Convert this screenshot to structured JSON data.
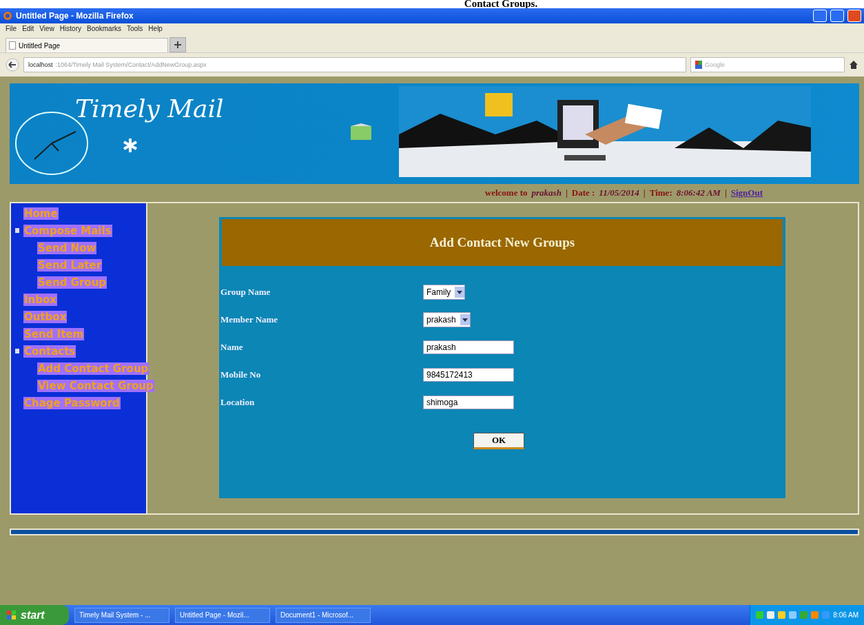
{
  "doc_heading": "Contact Groups.",
  "window": {
    "title": "Untitled Page - Mozilla Firefox"
  },
  "menu": [
    "File",
    "Edit",
    "View",
    "History",
    "Bookmarks",
    "Tools",
    "Help"
  ],
  "tabs": [
    {
      "label": "Untitled Page",
      "selected": true
    }
  ],
  "address": {
    "host": "localhost",
    "path": ":1064/Timely Mail System/Contact/AddNewGroup.aspx"
  },
  "search": {
    "placeholder": "Google"
  },
  "banner": {
    "title": "Timely Mail"
  },
  "welcome": [
    {
      "kind": "label",
      "text": "welcome to"
    },
    {
      "kind": "value",
      "text": "prakash"
    },
    {
      "kind": "sep",
      "text": "|"
    },
    {
      "kind": "label",
      "text": "Date :"
    },
    {
      "kind": "value",
      "text": "11/05/2014"
    },
    {
      "kind": "sep",
      "text": "|"
    },
    {
      "kind": "label",
      "text": "Time:"
    },
    {
      "kind": "value",
      "text": "8:06:42 AM"
    },
    {
      "kind": "sep",
      "text": "|"
    },
    {
      "kind": "link",
      "text": "SignOut"
    }
  ],
  "sidebar": {
    "items": [
      {
        "label": "Home"
      },
      {
        "label": "Compose Mails",
        "expanded": true,
        "children": [
          {
            "label": "Send Now"
          },
          {
            "label": "Send Later"
          },
          {
            "label": "Send Group"
          }
        ]
      },
      {
        "label": "Inbox"
      },
      {
        "label": "Outbox"
      },
      {
        "label": "Send Item"
      },
      {
        "label": "Contacts",
        "expanded": true,
        "children": [
          {
            "label": "Add Contact Group"
          },
          {
            "label": "View Contact Group"
          }
        ]
      },
      {
        "label": "Chage Password"
      }
    ]
  },
  "form": {
    "title": "Add Contact New Groups",
    "fields": [
      {
        "kind": "select",
        "label": "Group Name",
        "value": "Family"
      },
      {
        "kind": "select",
        "label": "Member Name",
        "value": "prakash"
      },
      {
        "kind": "text",
        "label": "Name",
        "value": "prakash"
      },
      {
        "kind": "text",
        "label": "Mobile No",
        "value": "9845172413"
      },
      {
        "kind": "text",
        "label": "Location",
        "value": "shimoga"
      }
    ],
    "button": "OK"
  },
  "taskbar": {
    "start": "start",
    "tasks": [
      "Timely Mail System - ...",
      "Untitled Page - Mozil...",
      "Document1 - Microsof..."
    ],
    "clock": "8:06 AM"
  }
}
